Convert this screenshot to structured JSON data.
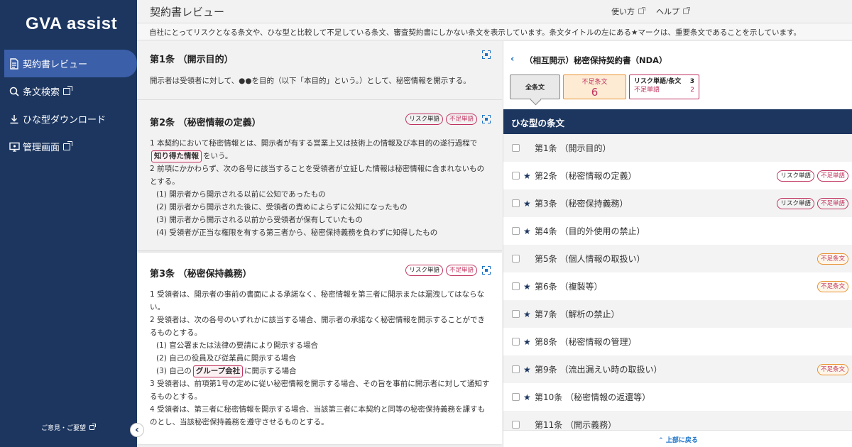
{
  "sidebar": {
    "logo": "GVA assist",
    "items": [
      {
        "label": "契約書レビュー",
        "icon": "document-icon",
        "active": true
      },
      {
        "label": "条文検索",
        "icon": "search-icon",
        "external": true
      },
      {
        "label": "ひな型ダウンロード",
        "icon": "download-icon"
      },
      {
        "label": "管理画面",
        "icon": "admin-monitor-icon",
        "external": true
      }
    ],
    "feedback": "ご意見・ご要望"
  },
  "header": {
    "title": "契約書レビュー",
    "usage": "使い方",
    "help": "ヘルプ"
  },
  "info": "自社にとってリスクとなる条文や、ひな型と比較して不足している条文、審査契約書にしかない条文を表示しています。条文タイトルの左にある★マークは、重要条文であることを示しています。",
  "articles": [
    {
      "title": "第1条 （開示目的）",
      "body": "開示者は受領者に対して、●●を目的（以下「本目的」という。）として、秘密情報を開示する。"
    },
    {
      "title": "第2条 （秘密情報の定義）",
      "tag_risk": "リスク単語",
      "tag_nf": "不足単語",
      "line1": "1 本契約において秘密情報とは、開示者が有する営業上又は技術上の情報及び本目的の遂行過程で",
      "hl": "知り得た情報",
      "line2_after": "をいう。",
      "line3": "2 前項にかかわらず、次の各号に該当することを受領者が立証した情報は秘密情報に含まれないものとする。",
      "items": [
        "(1) 開示者から開示される以前に公知であったもの",
        "(2) 開示者から開示された後に、受領者の責めによらずに公知になったもの",
        "(3) 開示者から開示される以前から受領者が保有していたもの",
        "(4) 受領者が正当な権限を有する第三者から、秘密保持義務を負わずに知得したもの"
      ]
    },
    {
      "title": "第3条 （秘密保持義務）",
      "tag_risk": "リスク単語",
      "tag_nf": "不足単語",
      "p1": "1 受領者は、開示者の事前の書面による承諾なく、秘密情報を第三者に開示または漏洩してはならない。",
      "p2": "2 受領者は、次の各号のいずれかに該当する場合、開示者の承諾なく秘密情報を開示することができるものとする。",
      "items": [
        "(1) 官公署または法律の要請により開示する場合",
        "(2) 自己の役員及び従業員に開示する場合"
      ],
      "item3_before": "(3) 自己の",
      "hl": "グループ会社",
      "item3_after": "に開示する場合",
      "p3": "3 受領者は、前項第1号の定めに従い秘密情報を開示する場合、その旨を事前に開示者に対して通知するものとする。",
      "p4": "4 受領者は、第三者に秘密情報を開示する場合、当該第三者に本契約と同等の秘密保持義務を課すものとし、当該秘密保持義務を遵守させるものとする。"
    }
  ],
  "right": {
    "doc_title": "（相互開示）秘密保持契約書（NDA）",
    "all_label": "全条文",
    "missing_label": "不足条文",
    "missing_count": "6",
    "risk_label": "リスク単語/条文",
    "risk_count": "3",
    "nf_label": "不足単語",
    "nf_count": "2",
    "list_heading": "ひな型の条文",
    "list": [
      {
        "label": "第1条 （開示目的）",
        "star": false,
        "tags": []
      },
      {
        "label": "第2条 （秘密情報の定義）",
        "star": true,
        "tags": [
          "リスク単語",
          "不足単語"
        ]
      },
      {
        "label": "第3条 （秘密保持義務）",
        "star": true,
        "tags": [
          "リスク単語",
          "不足単語"
        ]
      },
      {
        "label": "第4条 （目的外使用の禁止）",
        "star": true,
        "tags": []
      },
      {
        "label": "第5条 （個人情報の取扱い）",
        "star": false,
        "tags": [
          "不足条文"
        ]
      },
      {
        "label": "第6条 （複製等）",
        "star": true,
        "tags": [
          "不足条文"
        ]
      },
      {
        "label": "第7条 （解析の禁止）",
        "star": true,
        "tags": []
      },
      {
        "label": "第8条 （秘密情報の管理）",
        "star": true,
        "tags": []
      },
      {
        "label": "第9条 （流出漏えい時の取扱い）",
        "star": true,
        "tags": [
          "不足条文"
        ]
      },
      {
        "label": "第10条 （秘密情報の返還等）",
        "star": true,
        "tags": []
      },
      {
        "label": "第11条 （開示義務）",
        "star": false,
        "tags": []
      }
    ],
    "back_top": "上部に戻る"
  },
  "colors": {
    "sidebar": "#1c3660",
    "active": "#3b5fa8",
    "accent": "#1a73c8",
    "risk": "#c0335e",
    "missing": "#e8912f"
  }
}
